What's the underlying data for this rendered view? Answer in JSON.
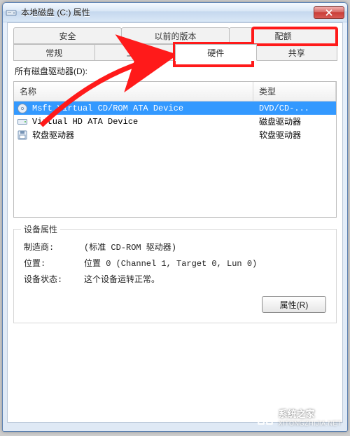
{
  "window": {
    "title": "本地磁盘 (C:) 属性"
  },
  "tabs": {
    "row1": [
      "安全",
      "以前的版本",
      "配额"
    ],
    "row2": [
      "常规",
      "工具",
      "硬件",
      "共享"
    ],
    "active": "硬件"
  },
  "list": {
    "label": "所有磁盘驱动器(D):",
    "columns": {
      "name": "名称",
      "type": "类型"
    },
    "rows": [
      {
        "name": "Msft Virtual CD/ROM ATA Device",
        "type": "DVD/CD-...",
        "icon": "cdrom-icon",
        "selected": true
      },
      {
        "name": "Virtual HD ATA Device",
        "type": "磁盘驱动器",
        "icon": "hdd-icon",
        "selected": false
      },
      {
        "name": "软盘驱动器",
        "type": "软盘驱动器",
        "icon": "floppy-icon",
        "selected": false
      }
    ]
  },
  "properties": {
    "legend": "设备属性",
    "manufacturer_label": "制造商:",
    "manufacturer_value": "(标准 CD-ROM 驱动器)",
    "location_label": "位置:",
    "location_value": "位置 0 (Channel 1, Target 0, Lun 0)",
    "status_label": "设备状态:",
    "status_value": "这个设备运转正常。"
  },
  "buttons": {
    "properties": "属性(R)"
  },
  "watermark": {
    "brand": "系统之家",
    "sub": "XITONGZHIJIA.NET"
  }
}
